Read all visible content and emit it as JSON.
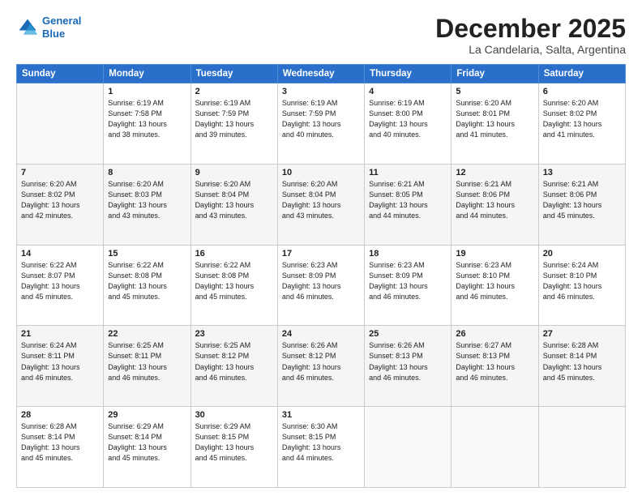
{
  "logo": {
    "line1": "General",
    "line2": "Blue"
  },
  "title": "December 2025",
  "subtitle": "La Candelaria, Salta, Argentina",
  "header_days": [
    "Sunday",
    "Monday",
    "Tuesday",
    "Wednesday",
    "Thursday",
    "Friday",
    "Saturday"
  ],
  "weeks": [
    [
      {
        "num": "",
        "info": ""
      },
      {
        "num": "1",
        "info": "Sunrise: 6:19 AM\nSunset: 7:58 PM\nDaylight: 13 hours\nand 38 minutes."
      },
      {
        "num": "2",
        "info": "Sunrise: 6:19 AM\nSunset: 7:59 PM\nDaylight: 13 hours\nand 39 minutes."
      },
      {
        "num": "3",
        "info": "Sunrise: 6:19 AM\nSunset: 7:59 PM\nDaylight: 13 hours\nand 40 minutes."
      },
      {
        "num": "4",
        "info": "Sunrise: 6:19 AM\nSunset: 8:00 PM\nDaylight: 13 hours\nand 40 minutes."
      },
      {
        "num": "5",
        "info": "Sunrise: 6:20 AM\nSunset: 8:01 PM\nDaylight: 13 hours\nand 41 minutes."
      },
      {
        "num": "6",
        "info": "Sunrise: 6:20 AM\nSunset: 8:02 PM\nDaylight: 13 hours\nand 41 minutes."
      }
    ],
    [
      {
        "num": "7",
        "info": "Sunrise: 6:20 AM\nSunset: 8:02 PM\nDaylight: 13 hours\nand 42 minutes."
      },
      {
        "num": "8",
        "info": "Sunrise: 6:20 AM\nSunset: 8:03 PM\nDaylight: 13 hours\nand 43 minutes."
      },
      {
        "num": "9",
        "info": "Sunrise: 6:20 AM\nSunset: 8:04 PM\nDaylight: 13 hours\nand 43 minutes."
      },
      {
        "num": "10",
        "info": "Sunrise: 6:20 AM\nSunset: 8:04 PM\nDaylight: 13 hours\nand 43 minutes."
      },
      {
        "num": "11",
        "info": "Sunrise: 6:21 AM\nSunset: 8:05 PM\nDaylight: 13 hours\nand 44 minutes."
      },
      {
        "num": "12",
        "info": "Sunrise: 6:21 AM\nSunset: 8:06 PM\nDaylight: 13 hours\nand 44 minutes."
      },
      {
        "num": "13",
        "info": "Sunrise: 6:21 AM\nSunset: 8:06 PM\nDaylight: 13 hours\nand 45 minutes."
      }
    ],
    [
      {
        "num": "14",
        "info": "Sunrise: 6:22 AM\nSunset: 8:07 PM\nDaylight: 13 hours\nand 45 minutes."
      },
      {
        "num": "15",
        "info": "Sunrise: 6:22 AM\nSunset: 8:08 PM\nDaylight: 13 hours\nand 45 minutes."
      },
      {
        "num": "16",
        "info": "Sunrise: 6:22 AM\nSunset: 8:08 PM\nDaylight: 13 hours\nand 45 minutes."
      },
      {
        "num": "17",
        "info": "Sunrise: 6:23 AM\nSunset: 8:09 PM\nDaylight: 13 hours\nand 46 minutes."
      },
      {
        "num": "18",
        "info": "Sunrise: 6:23 AM\nSunset: 8:09 PM\nDaylight: 13 hours\nand 46 minutes."
      },
      {
        "num": "19",
        "info": "Sunrise: 6:23 AM\nSunset: 8:10 PM\nDaylight: 13 hours\nand 46 minutes."
      },
      {
        "num": "20",
        "info": "Sunrise: 6:24 AM\nSunset: 8:10 PM\nDaylight: 13 hours\nand 46 minutes."
      }
    ],
    [
      {
        "num": "21",
        "info": "Sunrise: 6:24 AM\nSunset: 8:11 PM\nDaylight: 13 hours\nand 46 minutes."
      },
      {
        "num": "22",
        "info": "Sunrise: 6:25 AM\nSunset: 8:11 PM\nDaylight: 13 hours\nand 46 minutes."
      },
      {
        "num": "23",
        "info": "Sunrise: 6:25 AM\nSunset: 8:12 PM\nDaylight: 13 hours\nand 46 minutes."
      },
      {
        "num": "24",
        "info": "Sunrise: 6:26 AM\nSunset: 8:12 PM\nDaylight: 13 hours\nand 46 minutes."
      },
      {
        "num": "25",
        "info": "Sunrise: 6:26 AM\nSunset: 8:13 PM\nDaylight: 13 hours\nand 46 minutes."
      },
      {
        "num": "26",
        "info": "Sunrise: 6:27 AM\nSunset: 8:13 PM\nDaylight: 13 hours\nand 46 minutes."
      },
      {
        "num": "27",
        "info": "Sunrise: 6:28 AM\nSunset: 8:14 PM\nDaylight: 13 hours\nand 45 minutes."
      }
    ],
    [
      {
        "num": "28",
        "info": "Sunrise: 6:28 AM\nSunset: 8:14 PM\nDaylight: 13 hours\nand 45 minutes."
      },
      {
        "num": "29",
        "info": "Sunrise: 6:29 AM\nSunset: 8:14 PM\nDaylight: 13 hours\nand 45 minutes."
      },
      {
        "num": "30",
        "info": "Sunrise: 6:29 AM\nSunset: 8:15 PM\nDaylight: 13 hours\nand 45 minutes."
      },
      {
        "num": "31",
        "info": "Sunrise: 6:30 AM\nSunset: 8:15 PM\nDaylight: 13 hours\nand 44 minutes."
      },
      {
        "num": "",
        "info": ""
      },
      {
        "num": "",
        "info": ""
      },
      {
        "num": "",
        "info": ""
      }
    ]
  ]
}
